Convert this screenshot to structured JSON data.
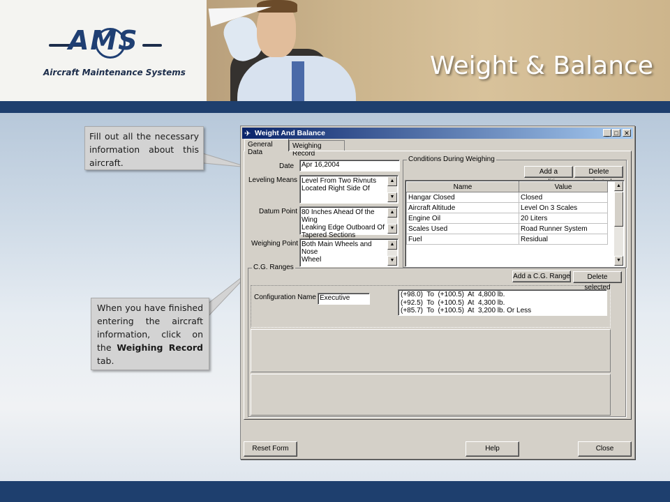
{
  "header": {
    "logo_text": "AMS",
    "logo_subtitle": "Aircraft Maintenance Systems",
    "title": "Weight & Balance"
  },
  "callouts": {
    "first": "Fill out all the necessary information about this aircraft.",
    "second_pre": "When you have finished entering the aircraft information, click on the ",
    "second_bold": "Weighing Record",
    "second_post": " tab."
  },
  "window": {
    "title": "Weight And Balance",
    "tabs": [
      "General Data",
      "Weighing Record"
    ],
    "date_label": "Date",
    "date_value": "Apr 16,2004",
    "leveling_label": "Leveling Means",
    "leveling_value": "Level From Two Rivnuts\nLocated Right Side Of",
    "datum_label": "Datum Point",
    "datum_value": "80 Inches Ahead Of the Wing\nLeaking Edge Outboard Of\nTapered Sections",
    "weighing_label": "Weighing Point",
    "weighing_value": "Both Main Wheels and Nose\nWheel",
    "conditions_title": "Conditions During Weighing",
    "add_condition": "Add a condition",
    "delete_selected": "Delete selected",
    "conditions_headers": [
      "Name",
      "Value"
    ],
    "conditions": [
      {
        "name": "Hangar Closed",
        "value": "Closed"
      },
      {
        "name": "Aircraft Altitude",
        "value": "Level On 3 Scales"
      },
      {
        "name": "Engine Oil",
        "value": "20 Liters"
      },
      {
        "name": "Scales Used",
        "value": "Road Runner System"
      },
      {
        "name": "Fuel",
        "value": "Residual"
      }
    ],
    "cg_title": "C.G. Ranges",
    "add_cg": "Add a C.G. Range",
    "delete_selected_cg": "Delete selected",
    "config_label": "Configuration Name :",
    "config_value": "Executive",
    "ranges": [
      "(+98.0)  To  (+100.5)  At  4,800 lb.",
      "(+92.5)  To  (+100.5)  At  4,300 lb.",
      "(+85.7)  To  (+100.5)  At  3,200 lb. Or Less"
    ],
    "reset_button": "Reset Form",
    "help_button": "Help",
    "close_button": "Close"
  }
}
